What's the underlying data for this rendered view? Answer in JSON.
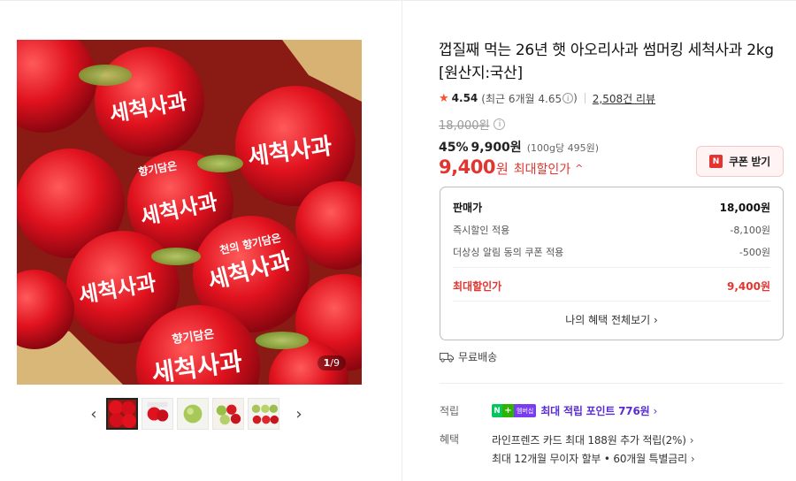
{
  "gallery": {
    "counter_current": "1",
    "counter_total": "/9",
    "thumbnails": [
      "thumb-1",
      "thumb-2",
      "thumb-3",
      "thumb-4",
      "thumb-5"
    ],
    "prev_icon": "chevron-left-icon",
    "next_icon": "chevron-right-icon",
    "main_image_caption_1": "세척사과",
    "main_image_caption_2": "향기담은",
    "main_image_caption_3": "천의 향기담은"
  },
  "product": {
    "title": "껍질째 먹는 26년 햇 아오리사과 썸머킹 세척사과 2kg [원산지:국산]",
    "rating": "4.54",
    "rating_recent": "(최근 6개월 4.65",
    "rating_recent_close": ")",
    "reviews": "2,508건 리뷰",
    "original_price": "18,000원",
    "discount_pct": "45%",
    "sale_price": "9,900원",
    "unit_price": "(100g당 495원)",
    "best_price": "9,400",
    "best_won": "원",
    "best_label": "최대할인가",
    "coupon_button": "쿠폰 받기",
    "coupon_badge": "N"
  },
  "price_box": {
    "rows": [
      {
        "label": "판매가",
        "value": "18,000원"
      },
      {
        "label": "즉시할인 적용",
        "value": "-8,100원"
      },
      {
        "label": "더상싱 알림 동의 쿠폰 적용",
        "value": "-500원"
      }
    ],
    "best_label": "최대할인가",
    "best_value": "9,400원",
    "benefit_link": "나의 혜택 전체보기"
  },
  "shipping": {
    "label": "무료배송",
    "icon": "truck-icon"
  },
  "points": {
    "label": "적립",
    "badge_n": "N",
    "badge_plus": "+",
    "badge_member": "멤버십",
    "text": "최대 적립 포인트 776원"
  },
  "benefits": {
    "label": "혜택",
    "line_1": "라인프렌즈 카드 최대 188원 추가 적립(2%)",
    "line_2": "최대 12개월 무이자 할부 • 60개월 특별금리"
  },
  "colors": {
    "accent_red": "#e3342f",
    "point_purple": "#5a2cd6",
    "naver_green": "#03c75a"
  }
}
